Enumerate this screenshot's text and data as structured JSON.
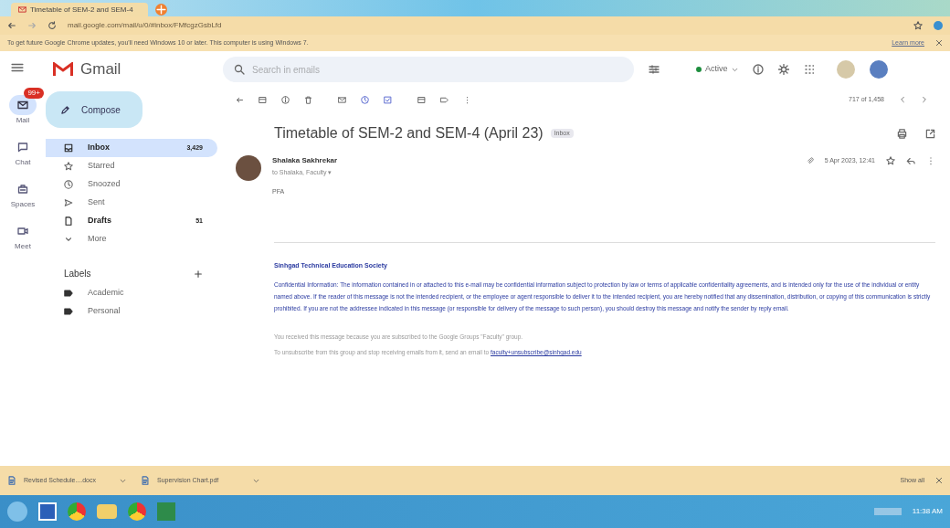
{
  "browser": {
    "tab_title": "Timetable of SEM-2 and SEM-4",
    "address": "mail.google.com/mail/u/0/#inbox/FMfcgzGsbLfd",
    "infobar_text": "To get future Google Chrome updates, you'll need Windows 10 or later. This computer is using Windows 7.",
    "infobar_link": "Learn more"
  },
  "gmail": {
    "logo_text": "Gmail",
    "search": {
      "placeholder": "Search in emails"
    },
    "status": "Active",
    "rail": [
      {
        "label": "Mail",
        "selected": true,
        "badge": "99+"
      },
      {
        "label": "Chat",
        "selected": false
      },
      {
        "label": "Spaces",
        "selected": false
      },
      {
        "label": "Meet",
        "selected": false
      }
    ],
    "compose": "Compose",
    "folders": [
      {
        "label": "Inbox",
        "count": "3,429",
        "selected": true,
        "bold": true
      },
      {
        "label": "Starred",
        "selected": false,
        "bold": false
      },
      {
        "label": "Snoozed",
        "selected": false,
        "bold": false
      },
      {
        "label": "Sent",
        "selected": false,
        "bold": false
      },
      {
        "label": "Drafts",
        "count": "51",
        "selected": false,
        "bold": true
      },
      {
        "label": "More",
        "selected": false,
        "bold": false
      }
    ],
    "labels_heading": "Labels",
    "labels": [
      "Academic",
      "Personal"
    ],
    "pager": "717 of 1,458",
    "message": {
      "subject": "Timetable of SEM-2 and SEM-4 (April 23)",
      "tag": "Inbox",
      "sender": "Shalaka Sakhrekar",
      "to": "to Shalaka, Faculty ▾",
      "date": "5 Apr 2023, 12:41",
      "body": "PFA",
      "org": "Sinhgad Technical Education Society",
      "disclaimer": "Confidential Information: The information contained in or attached to this e-mail may be confidential information subject to protection by law or terms of applicable confidentiality agreements, and is intended only for the use of the individual or entity named above. If the reader of this message is not the intended recipient, or the employee or agent responsible to deliver it to the intended recipient, you are hereby notified that any dissemination, distribution, or copying of this communication is strictly prohibited. If you are not the addressee indicated in this message (or responsible for delivery of the message to such person), you should destroy this message and notify the sender by reply email.",
      "footer_1": "You received this message because you are subscribed to the Google Groups \"Faculty\" group.",
      "footer_2": "To unsubscribe from this group and stop receiving emails from it, send an email to",
      "footer_link": "faculty+unsubscribe@sinhgad.edu"
    }
  },
  "downloads": {
    "items": [
      "Revised Schedule....docx",
      "Supervision Chart.pdf"
    ],
    "show_all": "Show all"
  },
  "taskbar": {
    "time": "11:38 AM"
  }
}
